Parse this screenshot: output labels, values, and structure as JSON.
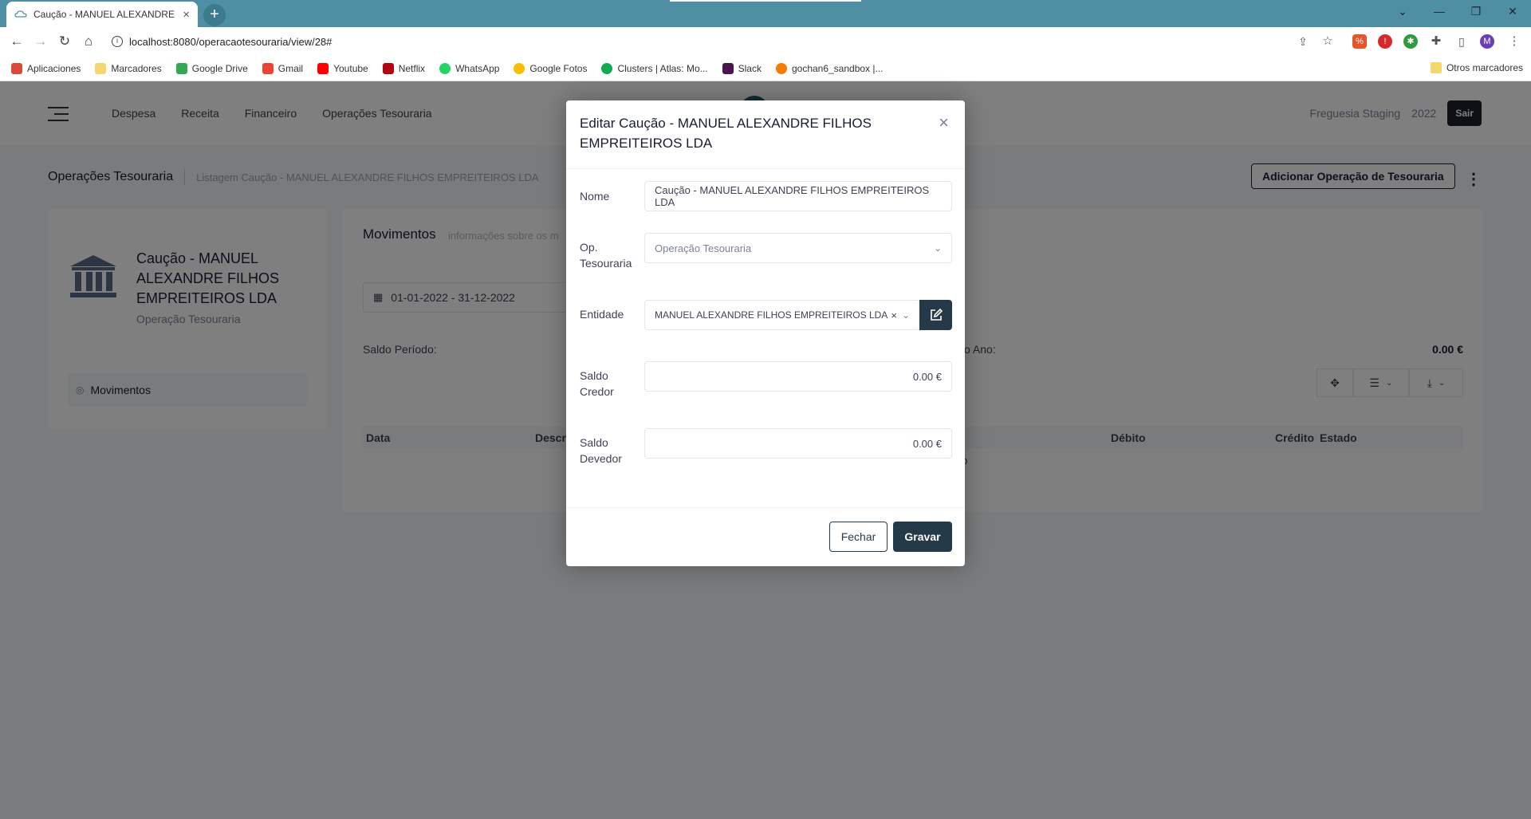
{
  "browser": {
    "tab_title": "Caução - MANUEL ALEXANDRE F",
    "tab_close": "×",
    "new_tab": "+",
    "url": "localhost:8080/operacaotesouraria/view/28#",
    "bookmarks": [
      "Aplicaciones",
      "Marcadores",
      "Google Drive",
      "Gmail",
      "Youtube",
      "Netflix",
      "WhatsApp",
      "Google Fotos",
      "Clusters | Atlas: Mo...",
      "Slack",
      "gochan6_sandbox |..."
    ],
    "other_bookmarks": "Otros marcadores",
    "profile_initial": "M"
  },
  "app": {
    "nav": [
      "Despesa",
      "Receita",
      "Financeiro",
      "Operações Tesouraria"
    ],
    "org": "Freguesia Staging",
    "year": "2022",
    "logout": "Sair",
    "page_title": "Operações Tesouraria",
    "breadcrumb": "Listagem  Caução - MANUEL ALEXANDRE FILHOS EMPREITEIROS LDA",
    "add_button": "Adicionar Operação de Tesouraria",
    "kebab": "⋮",
    "entity_name": "Caução - MANUEL ALEXANDRE FILHOS EMPREITEIROS LDA",
    "entity_type": "Operação Tesouraria",
    "side_nav_item": "Movimentos",
    "movements_title": "Movimentos",
    "movements_sub": "informações sobre os m",
    "date_range": "01-01-2022 - 31-12-2022",
    "saldo_periodo": "Saldo Período:",
    "saldo_ano_label": "o Ano:",
    "saldo_ano_value": "0.00 €",
    "table_headers": [
      "Data",
      "Descr",
      "Débito",
      "Crédito",
      "Estado"
    ],
    "no_data": "do"
  },
  "modal": {
    "title": "Editar Caução - MANUEL ALEXANDRE FILHOS EMPREITEIROS LDA",
    "close": "×",
    "nome_label": "Nome",
    "nome_value": "Caução - MANUEL ALEXANDRE FILHOS EMPREITEIROS LDA",
    "op_label": "Op. Tesouraria",
    "op_placeholder": "Operação Tesouraria",
    "entidade_label": "Entidade",
    "entidade_value": "MANUEL ALEXANDRE FILHOS EMPREITEIROS LDA",
    "clear": "×",
    "saldo_credor_label": "Saldo Credor",
    "saldo_credor_value": "0.00 €",
    "saldo_devedor_label": "Saldo Devedor",
    "saldo_devedor_value": "0.00 €",
    "fechar": "Fechar",
    "gravar": "Gravar"
  }
}
